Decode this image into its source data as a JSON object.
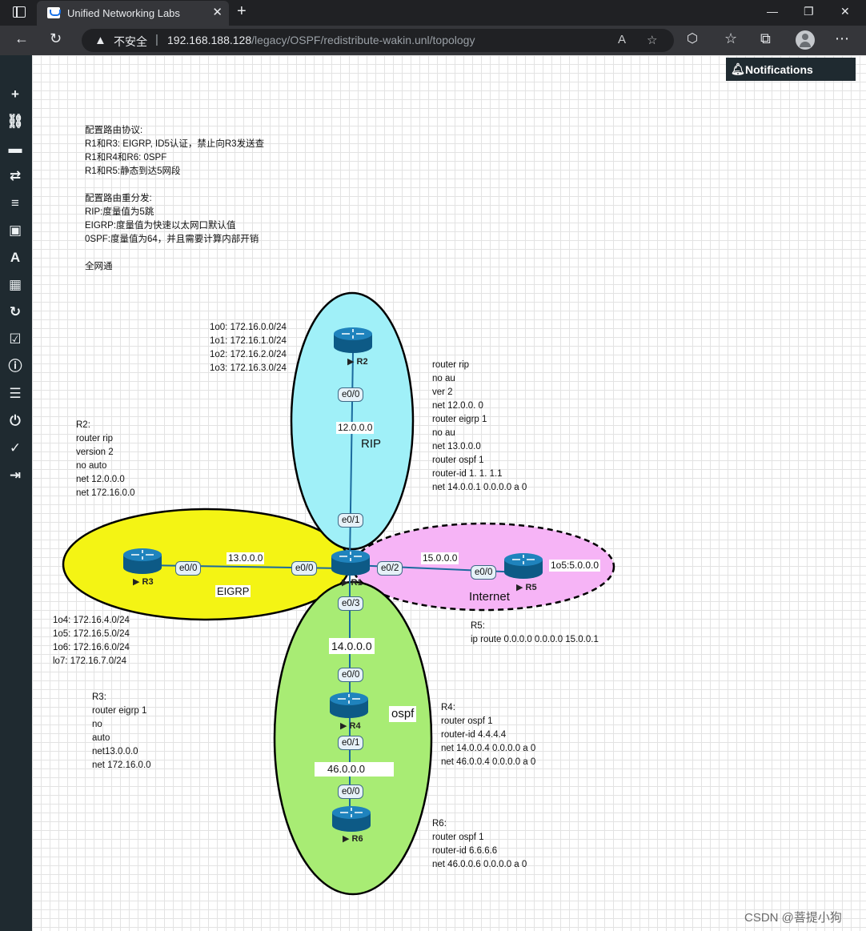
{
  "browser": {
    "tab_title": "Unified Networking Labs",
    "tab_close": "✕",
    "new_tab": "+",
    "insecure_label": "不安全",
    "url_host": "192.168.188.128",
    "url_path": "/legacy/OSPF/redistribute-wakin.unl/topology",
    "separator": "|",
    "minimize": "—",
    "restore": "❐",
    "close": "✕"
  },
  "notifications": {
    "label": "Notifications"
  },
  "instructions": [
    "配置路由协议:",
    "R1和R3: EIGRP, ID5认证，禁止向R3发送查",
    "R1和R4和R6: 0SPF",
    "R1和R5:静态到达5网段",
    "",
    "配置路由重分发:",
    "RIP:度量值为5跳",
    "EIGRP:度量值为快速以太网口默认值",
    "0SPF:度量值为64，并且需要计算内部开销",
    "",
    "全网通"
  ],
  "r2_loopbacks": [
    "1o0: 172.16.0.0/24",
    "1o1: 172.16.1.0/24",
    "1o2: 172.16.2.0/24",
    "1o3: 172.16.3.0/24"
  ],
  "r1_config": [
    "router rip",
    "no au",
    "ver 2",
    "net 12.0.0. 0",
    "router eigrp 1",
    "no au",
    "net 13.0.0.0",
    "router ospf 1",
    "router-id 1. 1. 1.1",
    "net 14.0.0.1 0.0.0.0 a 0"
  ],
  "r2_config": [
    "R2:",
    "router rip",
    "version 2",
    "no auto",
    "net 12.0.0.0",
    "net 172.16.0.0"
  ],
  "r3_loopbacks": [
    "1o4: 172.16.4.0/24",
    "1o5: 172.16.5.0/24",
    "1o6: 172.16.6.0/24",
    "lo7: 172.16.7.0/24"
  ],
  "r3_config": [
    "R3:",
    "router eigrp 1",
    "no",
    "auto",
    "net13.0.0.0",
    "net 172.16.0.0"
  ],
  "r5_config": [
    "R5:",
    "ip route 0.0.0.0 0.0.0.0 15.0.0.1"
  ],
  "r4_config": [
    "R4:",
    "router ospf 1",
    "router-id 4.4.4.4",
    "net 14.0.0.4 0.0.0.0 a 0",
    "net 46.0.0.4 0.0.0.0 a 0"
  ],
  "r6_config": [
    "R6:",
    "router ospf 1",
    "router-id 6.6.6.6",
    "net 46.0.0.6 0.0.0.0 a 0"
  ],
  "topology": {
    "routers": {
      "r1": "R1",
      "r2": "R2",
      "r3": "R3",
      "r4": "R4",
      "r5": "R5",
      "r6": "R6"
    },
    "zones": {
      "rip": "RIP",
      "eigrp": "EIGRP",
      "internet": "Internet",
      "ospf": "ospf"
    },
    "zone_colors": {
      "rip": "#a0f0f8",
      "eigrp": "#f4f414",
      "internet": "#f6b4f6",
      "ospf": "#a8ec74"
    },
    "networks": {
      "n12": "12.0.0.0",
      "n13": "13.0.0.0",
      "n15": "15.0.0.0",
      "n14": "14.0.0.0",
      "n46": "46.0.0.0",
      "r5_lo": "1o5:5.0.0.0"
    },
    "ports": {
      "r2_e00": "e0/0",
      "r1_e01": "e0/1",
      "r3_e00": "e0/0",
      "r1_e00": "e0/0",
      "r1_e02": "e0/2",
      "r5_e00": "e0/0",
      "r1_e03": "e0/3",
      "r4_e00": "e0/0",
      "r4_e01": "e0/1",
      "r6_e00": "e0/0"
    }
  },
  "watermark": "CSDN @菩提小狗"
}
